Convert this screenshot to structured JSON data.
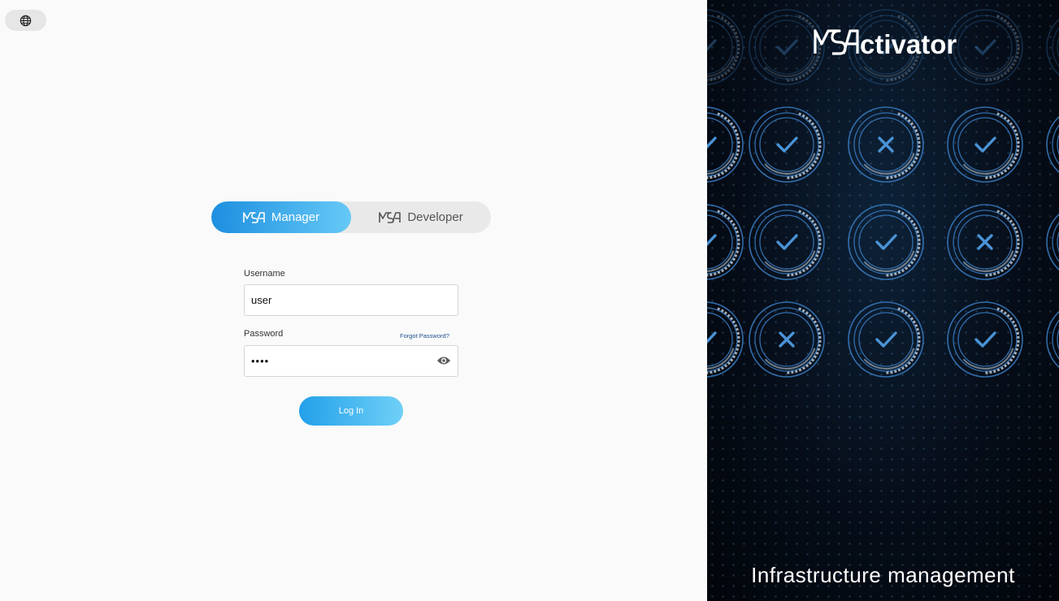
{
  "language_icon": "globe-icon",
  "switcher": {
    "manager_label": "Manager",
    "developer_label": "Developer",
    "active": "Manager",
    "logo_icon": "msa-logo-icon"
  },
  "form": {
    "username_label": "Username",
    "username_value": "user",
    "password_label": "Password",
    "password_value": "••••",
    "forgot_label": "Forgot Password?",
    "visibility_icon": "eye-icon",
    "login_label": "Log In"
  },
  "brand": {
    "logo_text": "MSActivator",
    "tagline": "Infrastructure management"
  },
  "colors": {
    "accent_start": "#1d8fe0",
    "accent_end": "#66c9f6",
    "ring": "#3a7ec4",
    "panel_bg": "#060d18"
  },
  "status_grid": [
    [
      "check",
      "cross",
      "check"
    ],
    [
      "check",
      "check",
      "cross"
    ],
    [
      "cross",
      "check",
      "check"
    ]
  ]
}
